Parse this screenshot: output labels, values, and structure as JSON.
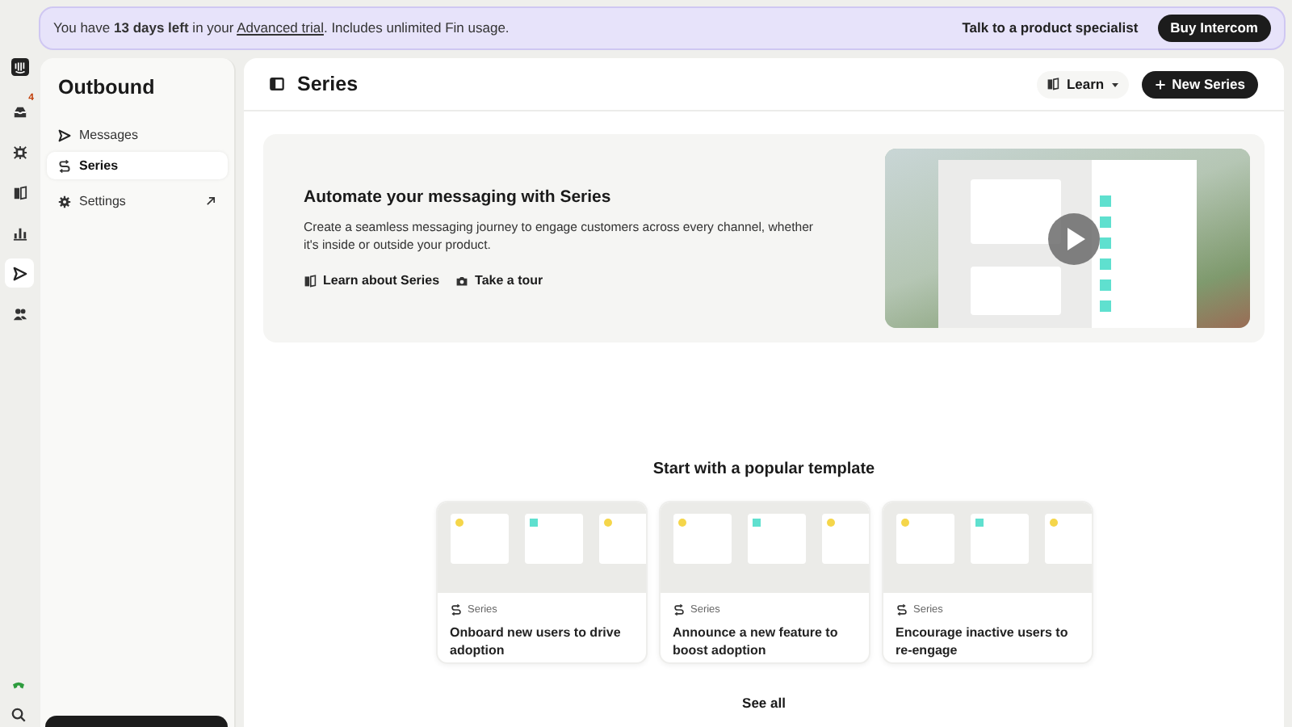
{
  "banner": {
    "parts": [
      "You have ",
      "**13 days left**",
      " in your ",
      "Advanced trial",
      ". Includes unlimited Fin usage."
    ],
    "specialist_link": "Talk to a product specialist",
    "buy_button": "Buy Intercom"
  },
  "rail": [
    {
      "kind": "inbox",
      "badge": "4",
      "selected": false
    },
    {
      "kind": "bot",
      "selected": false
    },
    {
      "kind": "book",
      "selected": false
    },
    {
      "kind": "chart",
      "selected": false
    },
    {
      "kind": "send",
      "selected": true
    },
    {
      "kind": "people",
      "selected": false
    }
  ],
  "sidebar": {
    "title": "Outbound",
    "items": [
      {
        "kind": "send",
        "label": "Messages",
        "selected": false
      },
      {
        "kind": "series",
        "label": "Series",
        "selected": true
      }
    ],
    "settings": {
      "label": "Settings"
    }
  },
  "header": {
    "title": "Series",
    "learn_button": "Learn",
    "new_button": "New Series"
  },
  "hero": {
    "title": "Automate your messaging with Series",
    "description": "Create a seamless messaging journey to engage customers across every channel, whether it's inside or outside your product.",
    "links": [
      {
        "kind": "book",
        "label": "Learn about Series"
      },
      {
        "kind": "camera",
        "label": "Take a tour"
      }
    ]
  },
  "templates": {
    "heading": "Start with a popular template",
    "cards": [
      {
        "tag": "Series",
        "title": "Onboard new users to drive adoption"
      },
      {
        "tag": "Series",
        "title": "Announce a new feature to boost adoption"
      },
      {
        "tag": "Series",
        "title": "Encourage inactive users to re-engage"
      }
    ],
    "see_all": "See all"
  }
}
